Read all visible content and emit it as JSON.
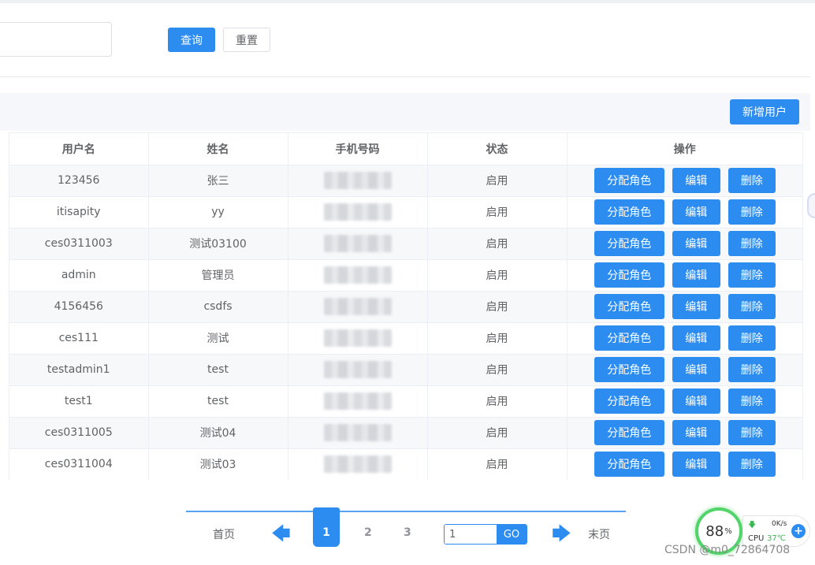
{
  "search": {
    "query_label": "查询",
    "reset_label": "重置",
    "input_value": "",
    "input_placeholder": ""
  },
  "toolbar": {
    "add_user_label": "新增用户"
  },
  "table": {
    "headers": [
      "用户名",
      "姓名",
      "手机号码",
      "状态",
      "操作"
    ],
    "rows": [
      {
        "username": "123456",
        "name": "张三",
        "status": "启用"
      },
      {
        "username": "itisapity",
        "name": "yy",
        "status": "启用"
      },
      {
        "username": "ces0311003",
        "name": "测试03100",
        "status": "启用"
      },
      {
        "username": "admin",
        "name": "管理员",
        "status": "启用"
      },
      {
        "username": "4156456",
        "name": "csdfs",
        "status": "启用"
      },
      {
        "username": "ces111",
        "name": "测试",
        "status": "启用"
      },
      {
        "username": "testadmin1",
        "name": "test",
        "status": "启用"
      },
      {
        "username": "test1",
        "name": "test",
        "status": "启用"
      },
      {
        "username": "ces0311005",
        "name": "测试04",
        "status": "启用"
      },
      {
        "username": "ces0311004",
        "name": "测试03",
        "status": "启用"
      }
    ],
    "actions": {
      "assign_role": "分配角色",
      "edit": "编辑",
      "delete": "删除"
    }
  },
  "pagination": {
    "first": "首页",
    "last": "末页",
    "pages": [
      "1",
      "2",
      "3"
    ],
    "current": "1",
    "jump_value": "1",
    "go_label": "GO"
  },
  "monitor": {
    "percent": "88",
    "percent_unit": "%",
    "net_speed": "0K/s",
    "cpu_label": "CPU",
    "cpu_temp": "37℃",
    "plus": "+"
  },
  "watermark": "CSDN @m0_72864708",
  "colors": {
    "primary": "#2d8cf0",
    "ring": "#52d46b"
  }
}
